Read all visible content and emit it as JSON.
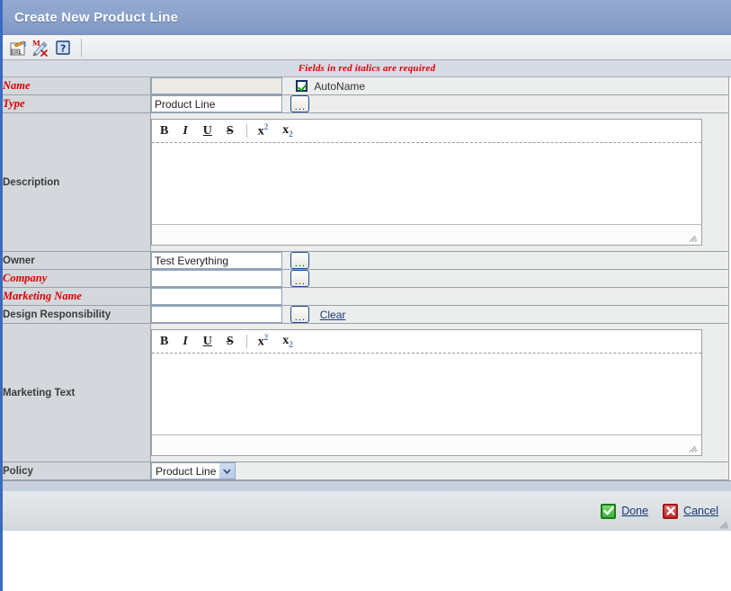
{
  "window": {
    "title": "Create New Product Line",
    "required_note": "Fields in red italics are required"
  },
  "toolbar": {
    "buttons": [
      {
        "name": "url-icon",
        "tooltip": "URL"
      },
      {
        "name": "mx-delete-icon",
        "tooltip": "MX"
      },
      {
        "name": "help-icon",
        "tooltip": "?"
      }
    ]
  },
  "editor_toolbar": {
    "bold": "B",
    "italic": "I",
    "underline": "U",
    "strike": "S",
    "superscript_base": "x",
    "superscript_exp": "2",
    "subscript_base": "x",
    "subscript_idx": "2"
  },
  "fields": {
    "name": {
      "label": "Name",
      "required": true,
      "value": "",
      "placeholder": "",
      "disabled": true,
      "autoname_label": "AutoName",
      "autoname_checked": true
    },
    "type": {
      "label": "Type",
      "required": true,
      "value": "Product Line",
      "placeholder": "",
      "browse": "..."
    },
    "description": {
      "label": "Description",
      "required": false,
      "value": ""
    },
    "owner": {
      "label": "Owner",
      "required": false,
      "value": "Test Everything",
      "placeholder": "",
      "browse": "..."
    },
    "company": {
      "label": "Company",
      "required": true,
      "value": "",
      "placeholder": "",
      "browse": "..."
    },
    "marketing_name": {
      "label": "Marketing Name",
      "required": true,
      "value": "",
      "placeholder": ""
    },
    "design_responsibility": {
      "label": "Design Responsibility",
      "required": false,
      "value": "",
      "placeholder": "",
      "browse": "...",
      "clear_link": "Clear"
    },
    "marketing_text": {
      "label": "Marketing Text",
      "required": false,
      "value": ""
    },
    "policy": {
      "label": "Policy",
      "required": false,
      "selected": "Product Line",
      "options": [
        "Product Line"
      ]
    }
  },
  "footer": {
    "done_label": "Done",
    "cancel_label": "Cancel"
  },
  "colors": {
    "titlebar_blue": "#8ba2cb",
    "required_red": "#dd0000",
    "link_blue": "#16387a",
    "label_bg": "#d4d8dd",
    "field_bg": "#eceded",
    "accent_border": "#3a6bbf"
  }
}
